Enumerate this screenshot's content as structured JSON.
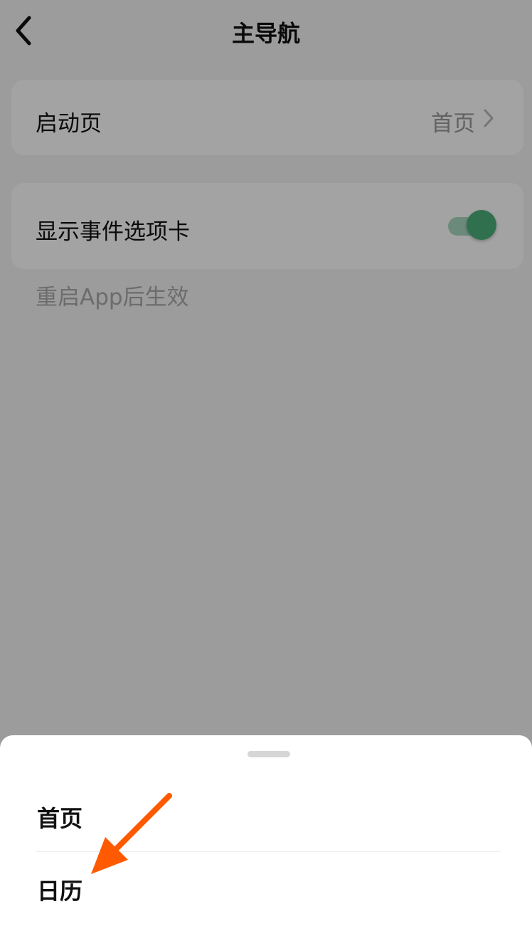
{
  "header": {
    "title": "主导航",
    "back_icon": "chevron-left-icon"
  },
  "settings": {
    "launch_page": {
      "label": "启动页",
      "value": "首页",
      "chevron_icon": "chevron-right-icon"
    },
    "show_events_tab": {
      "label": "显示事件选项卡",
      "enabled": true
    },
    "hint": "重启App后生效"
  },
  "sheet": {
    "options": [
      "首页",
      "日历"
    ]
  },
  "colors": {
    "accent": "#4caf7a",
    "overlay": "rgba(0,0,0,0.36)",
    "annotation_arrow": "#ff5a00"
  }
}
